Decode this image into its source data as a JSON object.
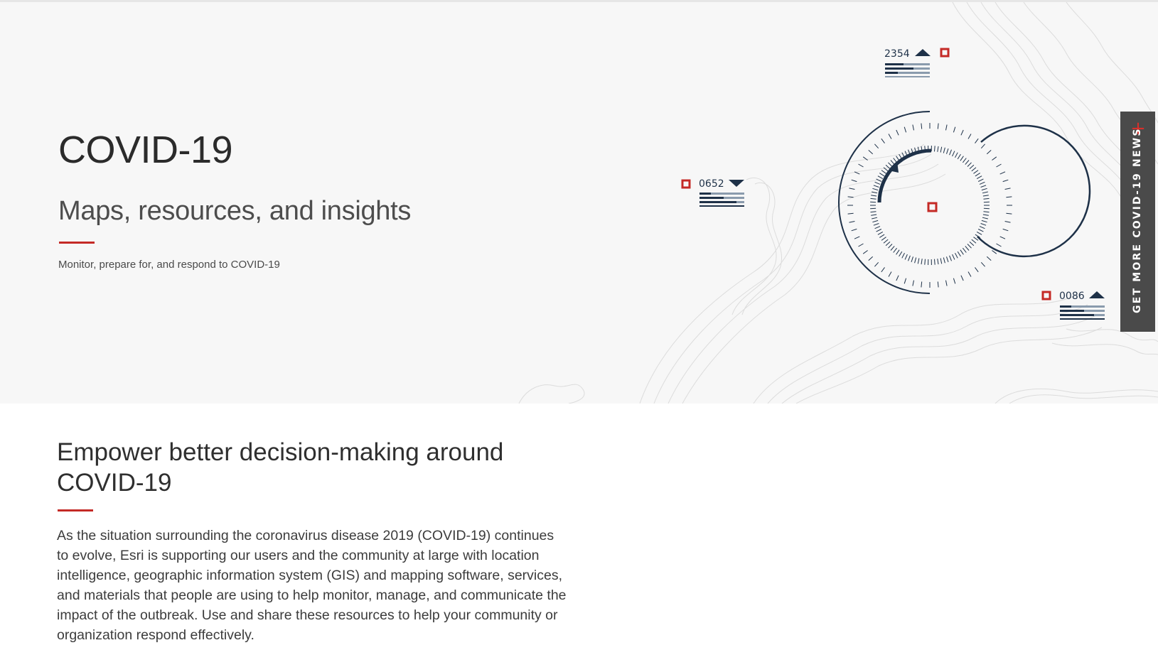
{
  "hero": {
    "title": "COVID-19",
    "subtitle": "Maps, resources, and insights",
    "tagline": "Monitor, prepare for, and respond to COVID-19"
  },
  "stats": [
    {
      "value": "2354",
      "trend": "up"
    },
    {
      "value": "0652",
      "trend": "down"
    },
    {
      "value": "0086",
      "trend": "up"
    }
  ],
  "side_tab": {
    "label": "GET MORE COVID-19 NEWS",
    "icon": "plus-icon"
  },
  "section": {
    "heading": "Empower better decision-making around COVID-19",
    "body": "As the situation surrounding the coronavirus disease 2019 (COVID-19) continues to evolve, Esri is supporting our users and the community at large with location intelligence, geographic information system (GIS) and mapping software, services, and materials that people are using to help monitor, manage, and communicate the impact of the outbreak. Use and share these resources to help your community or organization respond effectively."
  },
  "colors": {
    "accent_red": "#c42a26",
    "navy": "#1e3148",
    "hero_bg": "#f7f7f7",
    "tab_bg": "#4a4a4a"
  }
}
